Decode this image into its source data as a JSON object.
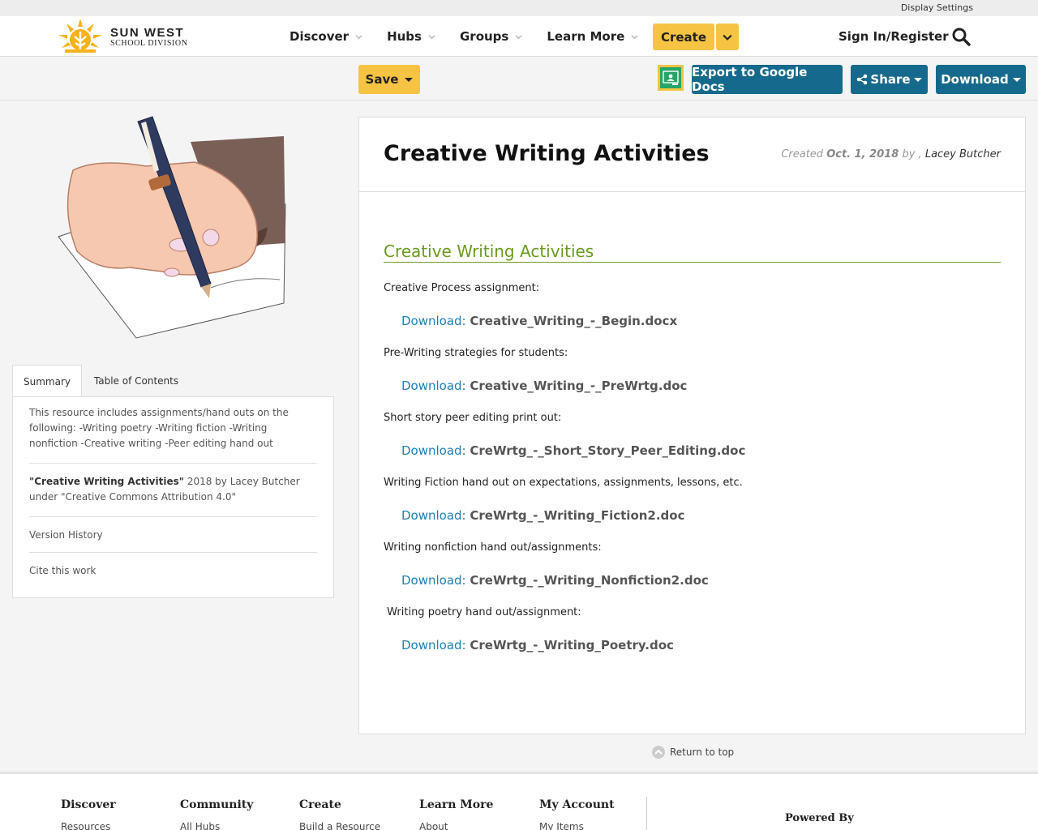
{
  "topbar": {
    "display_settings": "Display Settings"
  },
  "logo": {
    "main": "SUN WEST",
    "sub": "SCHOOL DIVISION"
  },
  "nav": {
    "items": [
      {
        "label": "Discover"
      },
      {
        "label": "Hubs"
      },
      {
        "label": "Groups"
      },
      {
        "label": "Learn More"
      }
    ],
    "create": "Create",
    "signin": "Sign In/Register"
  },
  "toolbar": {
    "save": "Save",
    "export": "Export to Google Docs",
    "share": "Share",
    "download": "Download"
  },
  "sidebar": {
    "tabs": [
      "Summary",
      "Table of Contents"
    ],
    "summary": "This resource includes assignments/hand outs on the following: -Writing poetry -Writing fiction -Writing nonfiction -Creative writing -Peer editing hand out",
    "attribution": {
      "title": "\"Creative Writing Activities\"",
      "line1_rest": " 2018 by Lacey Butcher",
      "line2": "under \"Creative Commons Attribution 4.0\""
    },
    "version_history": "Version History",
    "cite": "Cite this work"
  },
  "main": {
    "title": "Creative Writing Activities",
    "created_label": "Created ",
    "created_date": "Oct. 1, 2018",
    "created_by": " by , ",
    "author": "Lacey Butcher",
    "section_title": "Creative Writing Activities",
    "download_word": "Download:",
    "items": [
      {
        "label": "Creative Process assignment:",
        "file": "Creative_Writing_-_Begin.docx"
      },
      {
        "label": "Pre-Writing strategies for students:",
        "file": "Creative_Writing_-_PreWrtg.doc"
      },
      {
        "label": "Short story peer editing print out:",
        "file": "CreWrtg_-_Short_Story_Peer_Editing.doc"
      },
      {
        "label": "Writing Fiction hand out on expectations, assignments, lessons, etc.",
        "file": "CreWrtg_-_Writing_Fiction2.doc"
      },
      {
        "label": "Writing nonfiction hand out/assignments:",
        "file": "CreWrtg_-_Writing_Nonfiction2.doc"
      },
      {
        "label": " Writing poetry hand out/assignment:",
        "file": "CreWrtg_-_Writing_Poetry.doc"
      }
    ],
    "return_top": "Return to top"
  },
  "footer": {
    "columns": [
      {
        "head": "Discover",
        "link": "Resources"
      },
      {
        "head": "Community",
        "link": "All Hubs"
      },
      {
        "head": "Create",
        "link": "Build a Resource"
      },
      {
        "head": "Learn More",
        "link": "About"
      },
      {
        "head": "My Account",
        "link": "My Items"
      }
    ],
    "powered_by": "Powered By"
  },
  "colors": {
    "accent_yellow": "#f6c342",
    "teal_button": "#15698c",
    "section_green": "#6a9a1f",
    "link_blue": "#1d7fb5"
  }
}
